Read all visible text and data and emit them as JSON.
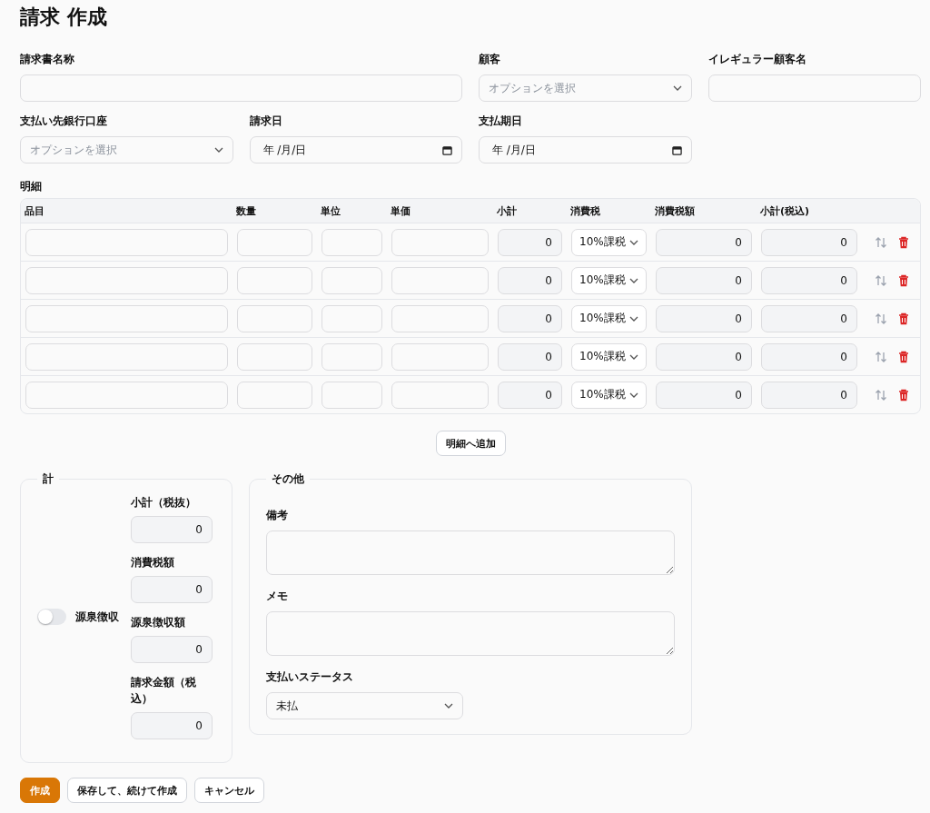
{
  "title": "請求 作成",
  "fields": [
    {
      "kind": "input",
      "label": "請求書名称"
    },
    {
      "kind": "select",
      "label": "顧客",
      "placeholder": "オプションを選択"
    },
    {
      "kind": "input",
      "label": "イレギュラー顧客名"
    },
    {
      "kind": "select",
      "label": "支払い先銀行口座",
      "placeholder": "オプションを選択"
    },
    {
      "kind": "date",
      "label": "請求日",
      "placeholder": "年 /月/日"
    },
    {
      "kind": "date",
      "label": "支払期日",
      "placeholder": "年 /月/日"
    }
  ],
  "details": {
    "label": "明細",
    "columns": [
      "品目",
      "数量",
      "単位",
      "単価",
      "小計",
      "消費税",
      "消費税額",
      "小計(税込)"
    ],
    "rows": [
      {
        "subtotal": "0",
        "tax": "10%課税",
        "tax_amount": "0",
        "total": "0"
      },
      {
        "subtotal": "0",
        "tax": "10%課税",
        "tax_amount": "0",
        "total": "0"
      },
      {
        "subtotal": "0",
        "tax": "10%課税",
        "tax_amount": "0",
        "total": "0"
      },
      {
        "subtotal": "0",
        "tax": "10%課税",
        "tax_amount": "0",
        "total": "0"
      },
      {
        "subtotal": "0",
        "tax": "10%課税",
        "tax_amount": "0",
        "total": "0"
      }
    ],
    "add_button": "明細へ追加"
  },
  "totals": {
    "legend": "計",
    "withholding": {
      "label": "源泉徴収",
      "on": false
    },
    "fields": [
      {
        "label": "小計（税抜）",
        "value": "0"
      },
      {
        "label": "消費税額",
        "value": "0"
      },
      {
        "label": "源泉徴収額",
        "value": "0"
      },
      {
        "label": "請求金額（税込）",
        "value": "0"
      }
    ]
  },
  "other": {
    "legend": "その他",
    "fields": [
      {
        "kind": "textarea",
        "label": "備考"
      },
      {
        "kind": "textarea",
        "label": "メモ"
      },
      {
        "kind": "select",
        "label": "支払いステータス",
        "value": "未払"
      }
    ]
  },
  "buttons": [
    {
      "kind": "primary",
      "label": "作成"
    },
    {
      "kind": "secondary",
      "label": "保存して、続けて作成"
    },
    {
      "kind": "secondary",
      "label": "キャンセル"
    }
  ]
}
